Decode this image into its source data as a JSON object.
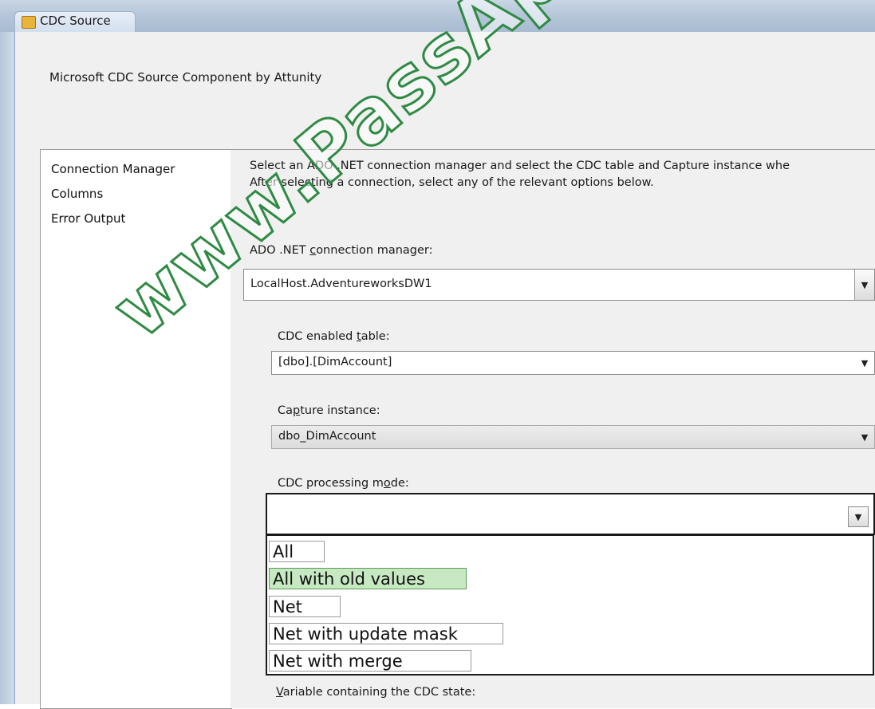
{
  "window": {
    "title": "CDC Source"
  },
  "component_title": "Microsoft CDC Source Component by Attunity",
  "nav": {
    "items": [
      {
        "label": "Connection Manager",
        "selected": true
      },
      {
        "label": "Columns",
        "selected": false
      },
      {
        "label": "Error Output",
        "selected": false
      }
    ]
  },
  "description": {
    "line1": "Select an ADO .NET connection manager and select the CDC table and Capture instance whe",
    "line2": "After selecting a connection, select any of the relevant options below."
  },
  "connection_manager": {
    "label_pre": "ADO .NET ",
    "label_accel": "c",
    "label_post": "onnection manager:",
    "value": "LocalHost.AdventureworksDW1"
  },
  "cdc_table": {
    "label_pre": "CDC enabled ",
    "label_accel": "t",
    "label_post": "able:",
    "value": "[dbo].[DimAccount]"
  },
  "capture_instance": {
    "label_pre": "Ca",
    "label_accel": "p",
    "label_post": "ture instance:",
    "value": "dbo_DimAccount"
  },
  "processing_mode": {
    "label_pre": "CDC processing m",
    "label_accel": "o",
    "label_post": "de:",
    "value": "",
    "options": [
      {
        "label": "All",
        "highlighted": false
      },
      {
        "label": "All with old values",
        "highlighted": true
      },
      {
        "label": "Net",
        "highlighted": false
      },
      {
        "label": "Net with update mask",
        "highlighted": false
      },
      {
        "label": "Net with merge",
        "highlighted": false
      }
    ]
  },
  "state_variable": {
    "label_accel": "V",
    "label_post": "ariable containing the CDC state:"
  },
  "watermark": "www.PassApply.com",
  "icons": {
    "window_icon": "cdc-source-icon",
    "dropdown_arrow": "chevron-down-icon"
  },
  "colors": {
    "highlight": "#c6e9c2",
    "watermark": "#2f8a43"
  }
}
